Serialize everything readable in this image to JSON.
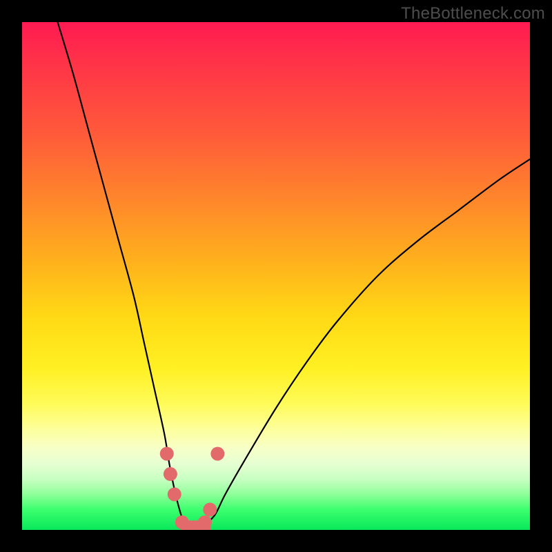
{
  "watermark": "TheBottleneck.com",
  "chart_data": {
    "type": "line",
    "title": "",
    "xlabel": "",
    "ylabel": "",
    "xlim": [
      0,
      100
    ],
    "ylim": [
      0,
      100
    ],
    "curve": {
      "note": "V-shaped bottleneck curve; y is approximate bottleneck percentage, x is relative performance index. Values estimated from pixel positions (no axis ticks rendered).",
      "x": [
        7,
        10,
        13,
        16,
        19,
        22,
        24,
        26,
        28,
        29,
        30,
        31,
        32,
        33,
        34,
        35,
        36,
        38,
        40,
        44,
        50,
        56,
        62,
        70,
        78,
        86,
        94,
        100
      ],
      "y": [
        100,
        90,
        79,
        68,
        57,
        46,
        37,
        28,
        19,
        13,
        8,
        4,
        1,
        0,
        0,
        0,
        1,
        3,
        7,
        14,
        24,
        33,
        41,
        50,
        57,
        63,
        69,
        73
      ]
    },
    "markers": {
      "note": "Highlighted optimal-range markers near the trough",
      "color": "#e26a6a",
      "points": [
        {
          "x": 28.5,
          "y": 15
        },
        {
          "x": 29.2,
          "y": 11
        },
        {
          "x": 30.0,
          "y": 7
        },
        {
          "x": 31.5,
          "y": 1.5
        },
        {
          "x": 33.0,
          "y": 0.5
        },
        {
          "x": 34.5,
          "y": 0.5
        },
        {
          "x": 36.0,
          "y": 1.5
        },
        {
          "x": 37.0,
          "y": 4
        },
        {
          "x": 38.5,
          "y": 15
        }
      ]
    }
  },
  "colors": {
    "marker": "#e26a6a",
    "curve": "#000000",
    "frame": "#000000"
  }
}
